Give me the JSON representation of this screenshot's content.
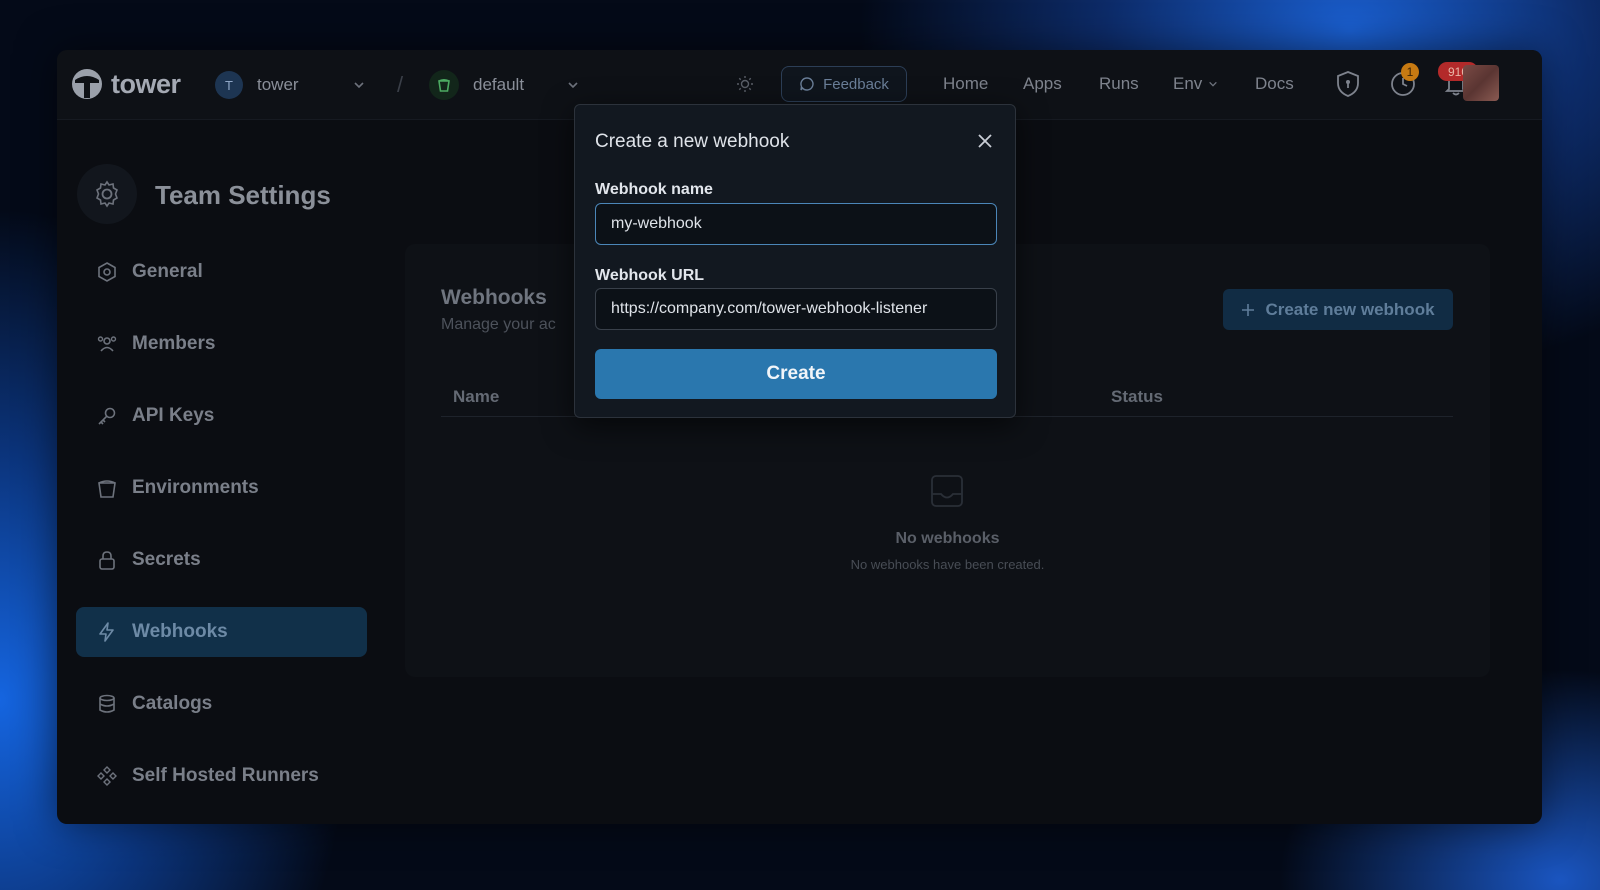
{
  "app": {
    "logo_text": "tower"
  },
  "topbar": {
    "team_initial": "T",
    "team_name": "tower",
    "environment": "default",
    "feedback_label": "Feedback",
    "nav": [
      {
        "label": "Home"
      },
      {
        "label": "Apps"
      },
      {
        "label": "Runs"
      },
      {
        "label": "Env"
      },
      {
        "label": "Docs"
      }
    ],
    "runs_badge": "1",
    "notification_count": "910"
  },
  "sidebar": {
    "title": "Team Settings",
    "items": [
      {
        "label": "General",
        "icon": "hexagon-gear-icon"
      },
      {
        "label": "Members",
        "icon": "users-icon"
      },
      {
        "label": "API Keys",
        "icon": "key-icon"
      },
      {
        "label": "Environments",
        "icon": "bucket-icon"
      },
      {
        "label": "Secrets",
        "icon": "lock-icon"
      },
      {
        "label": "Webhooks",
        "icon": "bolt-icon",
        "active": true
      },
      {
        "label": "Catalogs",
        "icon": "database-icon"
      },
      {
        "label": "Self Hosted Runners",
        "icon": "diamond-grid-icon"
      }
    ]
  },
  "main": {
    "title": "Webhooks",
    "subtitle": "Manage your ac",
    "create_button": "Create new webhook",
    "columns": [
      "Name",
      "Status"
    ],
    "empty_title": "No webhooks",
    "empty_subtitle": "No webhooks have been created."
  },
  "modal": {
    "title": "Create a new webhook",
    "name_label": "Webhook name",
    "name_value": "my-webhook",
    "url_label": "Webhook URL",
    "url_value": "https://company.com/tower-webhook-listener",
    "submit_label": "Create"
  },
  "colors": {
    "accent": "#2a77ae",
    "active_nav_bg": "#113049",
    "notification_badge": "#b32a2a",
    "runs_badge": "#c77a12"
  }
}
